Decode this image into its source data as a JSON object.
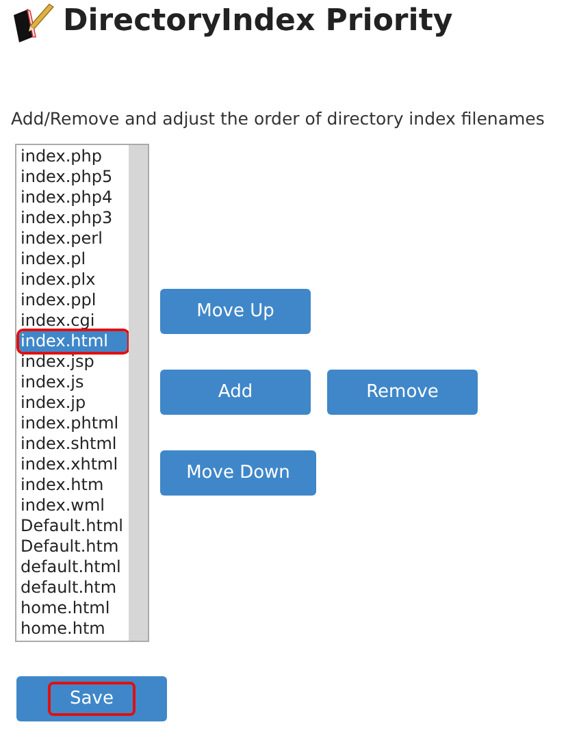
{
  "title": "DirectoryIndex Priority",
  "description": "Add/Remove and adjust the order of directory index filenames",
  "filenames": [
    {
      "label": "index.php",
      "selected": false,
      "annotated": false
    },
    {
      "label": "index.php5",
      "selected": false,
      "annotated": false
    },
    {
      "label": "index.php4",
      "selected": false,
      "annotated": false
    },
    {
      "label": "index.php3",
      "selected": false,
      "annotated": false
    },
    {
      "label": "index.perl",
      "selected": false,
      "annotated": false
    },
    {
      "label": "index.pl",
      "selected": false,
      "annotated": false
    },
    {
      "label": "index.plx",
      "selected": false,
      "annotated": false
    },
    {
      "label": "index.ppl",
      "selected": false,
      "annotated": false
    },
    {
      "label": "index.cgi",
      "selected": false,
      "annotated": false
    },
    {
      "label": "index.html",
      "selected": true,
      "annotated": true
    },
    {
      "label": "index.jsp",
      "selected": false,
      "annotated": false
    },
    {
      "label": "index.js",
      "selected": false,
      "annotated": false
    },
    {
      "label": "index.jp",
      "selected": false,
      "annotated": false
    },
    {
      "label": "index.phtml",
      "selected": false,
      "annotated": false
    },
    {
      "label": "index.shtml",
      "selected": false,
      "annotated": false
    },
    {
      "label": "index.xhtml",
      "selected": false,
      "annotated": false
    },
    {
      "label": "index.htm",
      "selected": false,
      "annotated": false
    },
    {
      "label": "index.wml",
      "selected": false,
      "annotated": false
    },
    {
      "label": "Default.html",
      "selected": false,
      "annotated": false
    },
    {
      "label": "Default.htm",
      "selected": false,
      "annotated": false
    },
    {
      "label": "default.html",
      "selected": false,
      "annotated": false
    },
    {
      "label": "default.htm",
      "selected": false,
      "annotated": false
    },
    {
      "label": "home.html",
      "selected": false,
      "annotated": false
    },
    {
      "label": "home.htm",
      "selected": false,
      "annotated": false
    }
  ],
  "buttons": {
    "move_up": "Move Up",
    "add": "Add",
    "remove": "Remove",
    "move_down": "Move Down"
  },
  "save_button": {
    "label": "Save",
    "annotated": true
  }
}
